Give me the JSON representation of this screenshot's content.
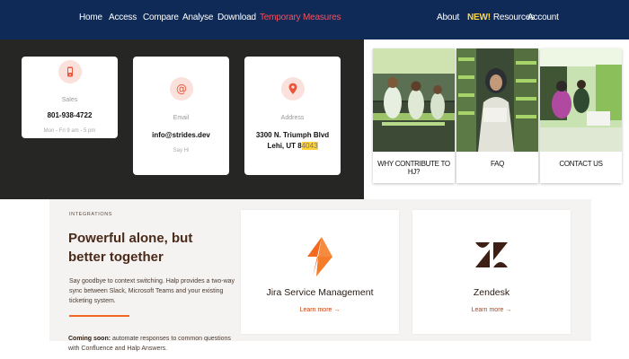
{
  "nav": {
    "left": [
      "Home",
      "Access",
      "Compare",
      "Analyse",
      "Download",
      "Temporary Measures"
    ],
    "right": {
      "about": "About",
      "resources_badge": "NEW!",
      "resources": "Resources",
      "account": "Account"
    }
  },
  "contact": {
    "sales": {
      "label": "Sales",
      "value": "801-938-4722",
      "sub": "Mon - Fri 9 am - 5 pm"
    },
    "email": {
      "label": "Email",
      "value": "info@strides.dev",
      "sub": "Say Hi"
    },
    "address": {
      "label": "Address",
      "line1": "3300 N. Triumph Blvd",
      "line2": "Lehi, UT 8",
      "zip_tail": "4043"
    }
  },
  "photo_cards": [
    "WHY CONTRIBUTE TO HJ?",
    "FAQ",
    "CONTACT US"
  ],
  "integrations": {
    "eyebrow": "INTEGRATIONS",
    "headline": "Powerful alone, but better together",
    "description": "Say goodbye to context switching. Halp provides a two-way sync between Slack, Microsoft Teams and your existing ticketing system.",
    "coming_soon_label": "Coming soon:",
    "coming_soon_text": " automate responses to common questions with Confluence and Halp Answers.",
    "cards": [
      {
        "name": "Jira Service Management",
        "link": "Learn more →"
      },
      {
        "name": "Zendesk",
        "link": "Learn more →"
      }
    ]
  },
  "colors": {
    "nav_bg": "#0f2a56",
    "nav_highlight": "#ff4d5a",
    "new_badge": "#ffd84a",
    "dark_panel": "#262624",
    "accent_orange": "#f2691f",
    "zendesk": "#3d1f15"
  },
  "icons": {
    "sales": "phone-icon",
    "email": "at-sign-icon",
    "address": "map-pin-icon",
    "jira": "jira-logo",
    "zendesk": "zendesk-logo"
  }
}
